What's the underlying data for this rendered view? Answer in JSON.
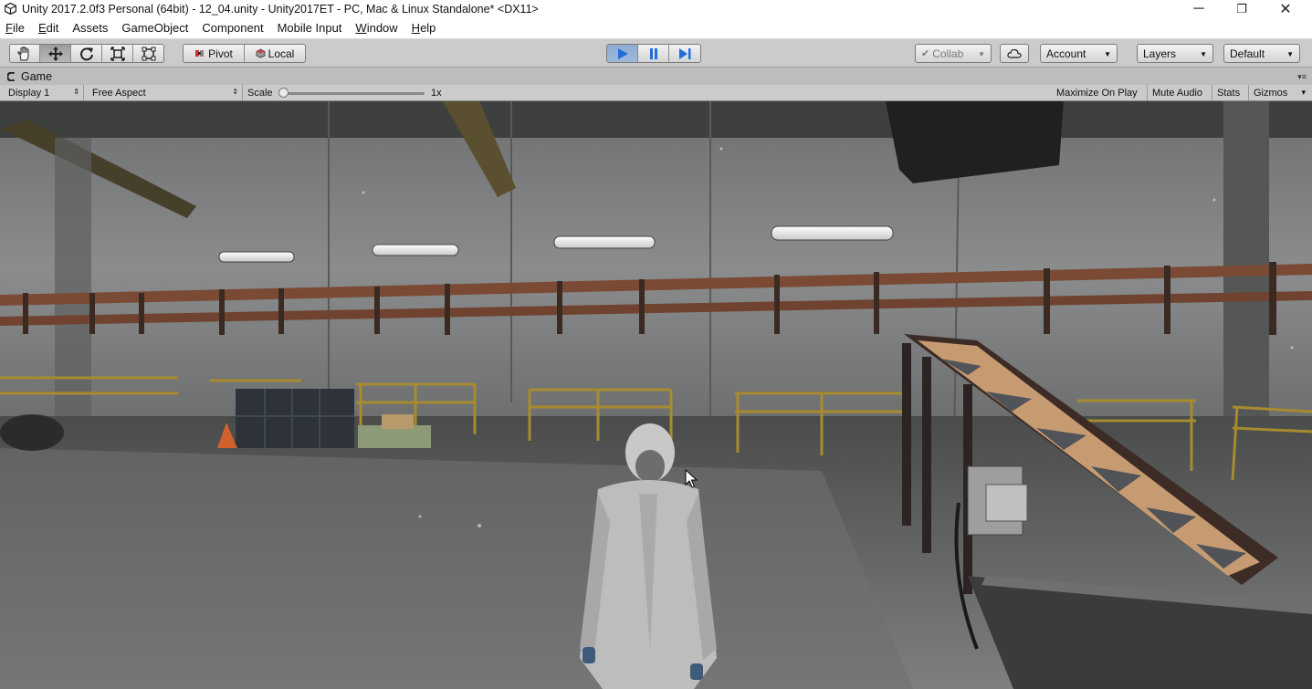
{
  "window": {
    "title": "Unity 2017.2.0f3 Personal (64bit) - 12_04.unity - Unity2017ET - PC, Mac & Linux Standalone* <DX11>",
    "minimize_glyph": "─",
    "restore_glyph": "❐",
    "close_glyph": "✕"
  },
  "menu": {
    "items": [
      {
        "label": "File",
        "underline": "F",
        "rest": "ile"
      },
      {
        "label": "Edit",
        "underline": "E",
        "rest": "dit"
      },
      {
        "label": "Assets",
        "underline": "",
        "rest": "Assets"
      },
      {
        "label": "GameObject",
        "underline": "",
        "rest": "GameObject"
      },
      {
        "label": "Component",
        "underline": "",
        "rest": "Component"
      },
      {
        "label": "Mobile Input",
        "underline": "",
        "rest": "Mobile Input"
      },
      {
        "label": "Window",
        "underline": "W",
        "rest": "indow"
      },
      {
        "label": "Help",
        "underline": "H",
        "rest": "elp"
      }
    ]
  },
  "toolbar": {
    "tools": [
      "hand-icon",
      "move-icon",
      "rotate-icon",
      "scale-icon",
      "rect-tool-icon"
    ],
    "active_tool": "move-icon",
    "pivot_label": "Pivot",
    "local_label": "Local",
    "play_state": "playing",
    "collab_label": "Collab",
    "account_label": "Account",
    "layers_label": "Layers",
    "layout_label": "Default"
  },
  "game_tab": {
    "label": "Game"
  },
  "game_bar": {
    "display": "Display 1",
    "aspect": "Free Aspect",
    "scale_label": "Scale",
    "scale_value": "1x",
    "maximize_on_play": "Maximize On Play",
    "mute_audio": "Mute Audio",
    "stats": "Stats",
    "gizmos": "Gizmos"
  },
  "colors": {
    "toolbar_bg": "#cbcbcb",
    "play_active": "#8faad0",
    "play_icon": "#1f6fd8"
  }
}
